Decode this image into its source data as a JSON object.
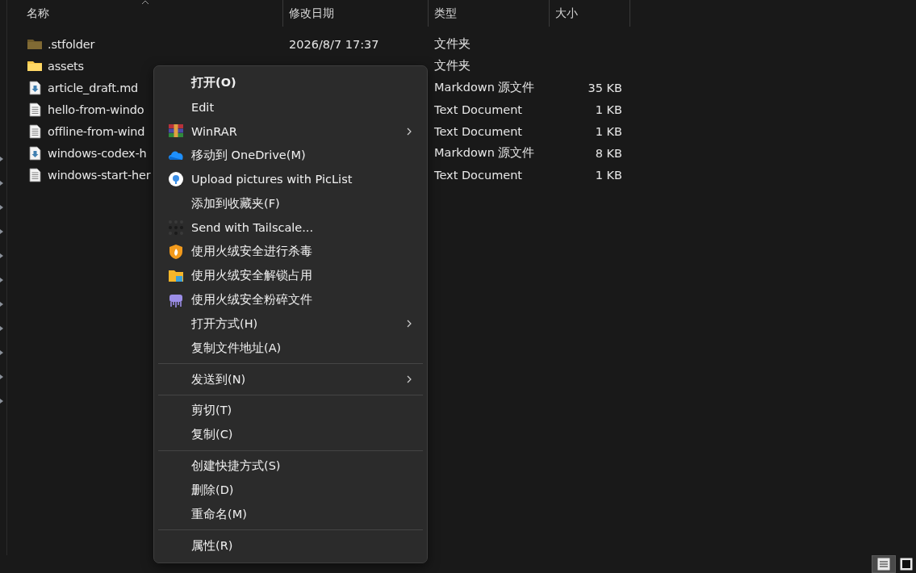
{
  "columns": [
    {
      "label": "名称",
      "sorted": true
    },
    {
      "label": "修改日期",
      "sorted": false
    },
    {
      "label": "类型",
      "sorted": false
    },
    {
      "label": "大小",
      "sorted": false
    }
  ],
  "files": [
    {
      "kind": "hidden-folder",
      "name": ".stfolder",
      "date": "2026/8/7 17:37",
      "type": "文件夹"
    },
    {
      "kind": "folder",
      "name": "assets",
      "type": "文件夹"
    },
    {
      "kind": "markdown",
      "name": "article_draft.md",
      "type": "Markdown 源文件",
      "size": "35 KB"
    },
    {
      "kind": "text",
      "name": "hello-from-windo",
      "type": "Text Document",
      "size": "1 KB"
    },
    {
      "kind": "text",
      "name": "offline-from-wind",
      "type": "Text Document",
      "size": "1 KB"
    },
    {
      "kind": "markdown",
      "name": "windows-codex-h",
      "type": "Markdown 源文件",
      "size": "8 KB"
    },
    {
      "kind": "text",
      "name": "windows-start-her",
      "type": "Text Document",
      "size": "1 KB"
    }
  ],
  "context_menu": [
    {
      "kind": "item",
      "label": "打开(O)",
      "default": true
    },
    {
      "kind": "item",
      "label": "Edit",
      "default": false
    },
    {
      "kind": "books",
      "label": "WinRAR",
      "submenu": true,
      "default": false
    },
    {
      "kind": "cloud",
      "label": "移动到 OneDrive(M)",
      "default": false
    },
    {
      "kind": "circle",
      "label": "Upload pictures with PicList",
      "default": false
    },
    {
      "kind": "item",
      "label": "添加到收藏夹(F)",
      "default": false
    },
    {
      "kind": "dots",
      "label": "Send with Tailscale...",
      "default": false
    },
    {
      "kind": "shield",
      "label": "使用火绒安全进行杀毒",
      "default": false
    },
    {
      "kind": "lockfolder",
      "label": "使用火绒安全解锁占用",
      "default": false
    },
    {
      "kind": "shredder",
      "label": "使用火绒安全粉碎文件",
      "default": false
    },
    {
      "kind": "item",
      "label": "打开方式(H)",
      "submenu": true,
      "default": false
    },
    {
      "kind": "item",
      "label": "复制文件地址(A)",
      "default": false
    },
    {
      "kind": "separator"
    },
    {
      "kind": "item",
      "label": "发送到(N)",
      "submenu": true,
      "default": false
    },
    {
      "kind": "separator"
    },
    {
      "kind": "item",
      "label": "剪切(T)",
      "default": false
    },
    {
      "kind": "item",
      "label": "复制(C)",
      "default": false
    },
    {
      "kind": "separator"
    },
    {
      "kind": "item",
      "label": "创建快捷方式(S)",
      "default": false
    },
    {
      "kind": "item",
      "label": "删除(D)",
      "default": false
    },
    {
      "kind": "item",
      "label": "重命名(M)",
      "default": false
    },
    {
      "kind": "separator"
    },
    {
      "kind": "item",
      "label": "属性(R)",
      "default": false
    }
  ],
  "view_buttons": [
    {
      "kind": "details",
      "selected": true
    },
    {
      "kind": "tiles",
      "selected": false
    }
  ]
}
